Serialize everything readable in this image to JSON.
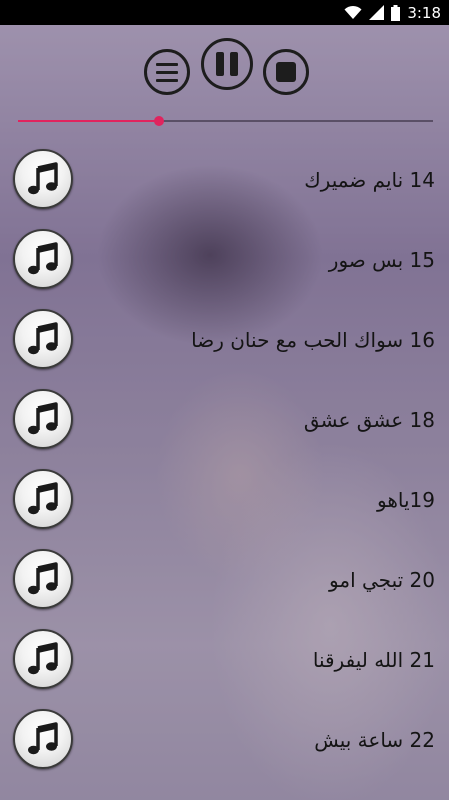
{
  "status_bar": {
    "time": "3:18"
  },
  "player": {
    "progress": 0.34
  },
  "tracks": [
    {
      "title": "14 نايم ضميرك"
    },
    {
      "title": "15 بس صور"
    },
    {
      "title": "16 سواك الحب مع حنان رضا"
    },
    {
      "title": "18 عشق عشق"
    },
    {
      "title": "19ياهو"
    },
    {
      "title": "20 تبجي امو"
    },
    {
      "title": "21  الله ليفرقنا"
    },
    {
      "title": "22 ساعة بيش"
    }
  ],
  "icons": {
    "status": [
      "wifi-icon",
      "signal-icon",
      "battery-icon"
    ],
    "controls": [
      "menu-icon",
      "pause-icon",
      "stop-icon"
    ],
    "track": "music-note-icon"
  }
}
